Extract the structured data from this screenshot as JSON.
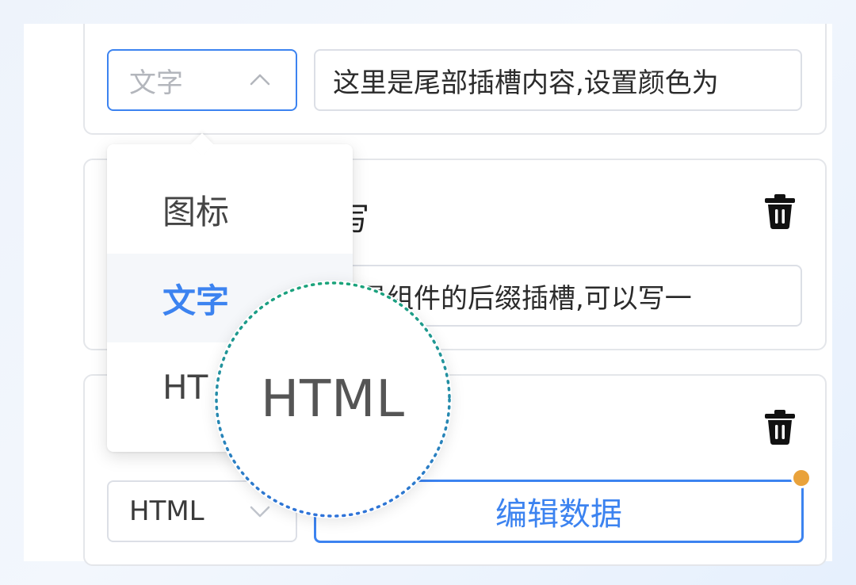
{
  "row1": {
    "type_select": {
      "value": "文字",
      "state": "open"
    },
    "content_input": {
      "value": "这里是尾部插槽内容,设置颜色为"
    }
  },
  "row2": {
    "label_fragment": "写",
    "content_input": {
      "value": "里是组件的后缀插槽,可以写一"
    },
    "delete_icon": "trash-icon"
  },
  "row3": {
    "type_select": {
      "value": "HTML"
    },
    "edit_button": {
      "label": "编辑数据"
    },
    "delete_icon": "trash-icon"
  },
  "dropdown": {
    "options": [
      {
        "label": "图标",
        "selected": false
      },
      {
        "label": "文字",
        "selected": true
      },
      {
        "label": "HT",
        "selected": false
      }
    ]
  },
  "magnifier": {
    "text": "HTML"
  },
  "colors": {
    "accent": "#3c83f0",
    "border": "#dcdfe6",
    "badge_dot": "#e9a23b",
    "magnifier_ring_start": "#1aa37a",
    "magnifier_ring_end": "#2f73d9"
  }
}
